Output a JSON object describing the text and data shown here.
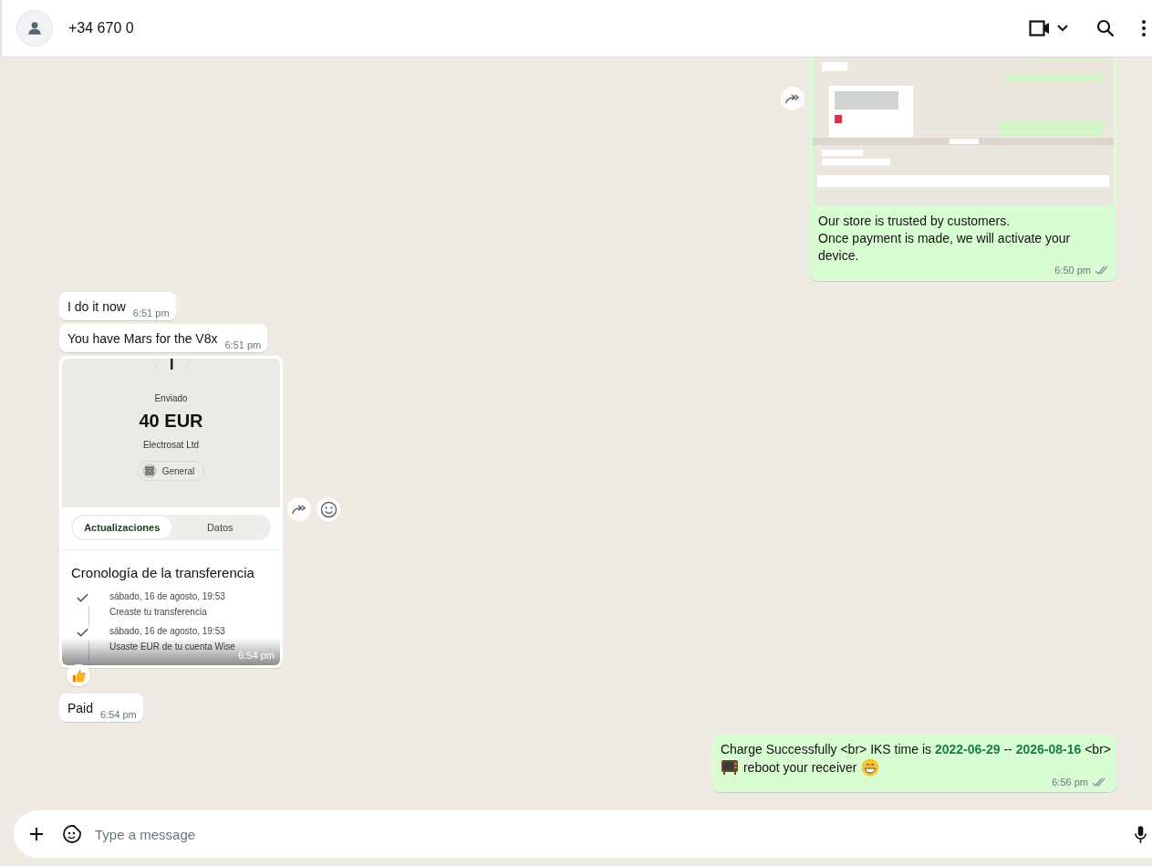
{
  "header": {
    "contact_name": "+34 670 0"
  },
  "messages": [
    {
      "kind": "image",
      "outgoing": true,
      "caption": "Our store is trusted by customers.\nOnce payment is made, we will activate your device.",
      "time": "6:50 pm",
      "delivered": true,
      "forward_button": true
    },
    {
      "kind": "text",
      "outgoing": false,
      "text": "I do it now",
      "time": "6:51 pm"
    },
    {
      "kind": "text",
      "outgoing": false,
      "text": "You have Mars for the V8x",
      "time": "6:51 pm"
    },
    {
      "kind": "transfer",
      "outgoing": false,
      "time": "6:54 pm",
      "reacted": true,
      "forward_button": true,
      "transfer": {
        "status_label": "Enviado",
        "amount": "40 EUR",
        "recipient": "Electrosat Ltd",
        "category": "General",
        "tabs": [
          {
            "label": "Actualizaciones",
            "selected": true
          },
          {
            "label": "Datos",
            "selected": false
          }
        ],
        "timeline_title": "Cronología de la transferencia",
        "events": [
          {
            "date": "sábado, 16 de agosto, 19:53",
            "text": "Creaste tu transferencia",
            "done": true
          },
          {
            "date": "sábado, 16 de agosto, 19:53",
            "text": "Usaste EUR de tu cuenta Wise",
            "done": true
          }
        ]
      }
    },
    {
      "kind": "text",
      "outgoing": false,
      "text": "Paid",
      "time": "6:54 pm"
    },
    {
      "kind": "status_text",
      "outgoing": true,
      "lines": [
        "Charge Successfully <br> IKS time is **2022-06-29** -- **2026-08-16** <br>",
        "reboot your receiver"
      ],
      "time": "6:56 pm",
      "delivered": true
    }
  ],
  "composer": {
    "placeholder": "Type a message"
  }
}
